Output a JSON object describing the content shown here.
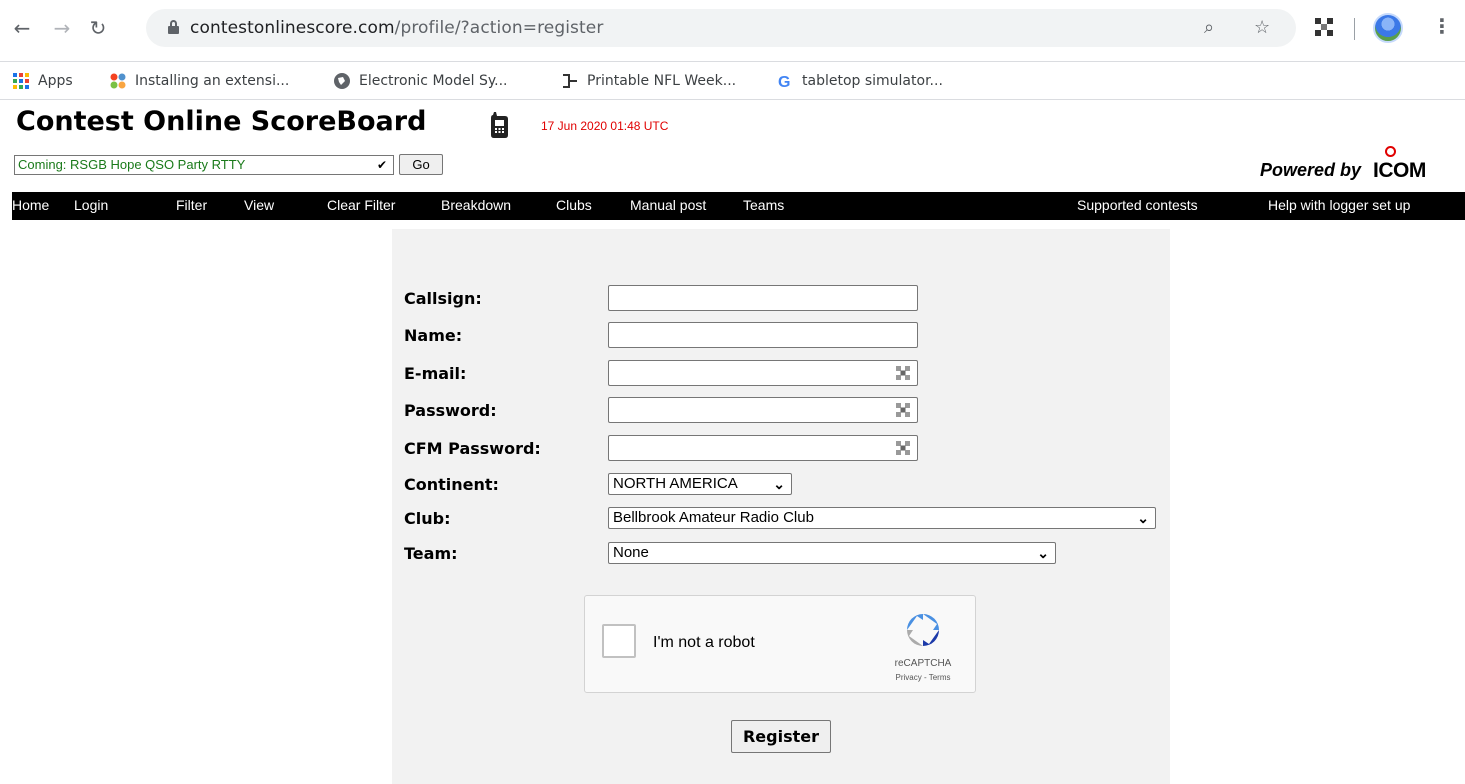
{
  "browser": {
    "url_host": "contestonlinescore.com",
    "url_path": "/profile/?action=register",
    "bookmarks": [
      {
        "label": "Apps"
      },
      {
        "label": "Installing an extensi..."
      },
      {
        "label": "Electronic Model Sy..."
      },
      {
        "label": "Printable NFL Week..."
      },
      {
        "label": "tabletop simulator..."
      }
    ]
  },
  "header": {
    "title": "Contest Online ScoreBoard",
    "timestamp": "17 Jun 2020 01:48 UTC",
    "contest_select": "Coming: RSGB Hope QSO Party RTTY",
    "go_label": "Go",
    "powered_by": "Powered by",
    "icom": "ICOM"
  },
  "menu": {
    "items": [
      "Home",
      "Login",
      "Filter",
      "View",
      "Clear Filter",
      "Breakdown",
      "Clubs",
      "Manual post",
      "Teams"
    ],
    "right_items": [
      "Supported contests",
      "Help with logger set up"
    ]
  },
  "form": {
    "labels": {
      "callsign": "Callsign:",
      "name": "Name:",
      "email": "E-mail:",
      "password": "Password:",
      "cfm_password": "CFM Password:",
      "continent": "Continent:",
      "club": "Club:",
      "team": "Team:"
    },
    "values": {
      "callsign": "",
      "name": "",
      "email": "",
      "password": "",
      "cfm_password": "",
      "continent": "NORTH AMERICA",
      "club": "Bellbrook Amateur Radio Club",
      "team": "None"
    },
    "captcha": {
      "label": "I'm not a robot",
      "brand": "reCAPTCHA",
      "links": "Privacy - Terms"
    },
    "register_label": "Register"
  },
  "colors": {
    "menubar": "#000000",
    "timestamp": "#e00000",
    "contest_text": "#1a7a1a",
    "panel": "#f2f2f2"
  }
}
